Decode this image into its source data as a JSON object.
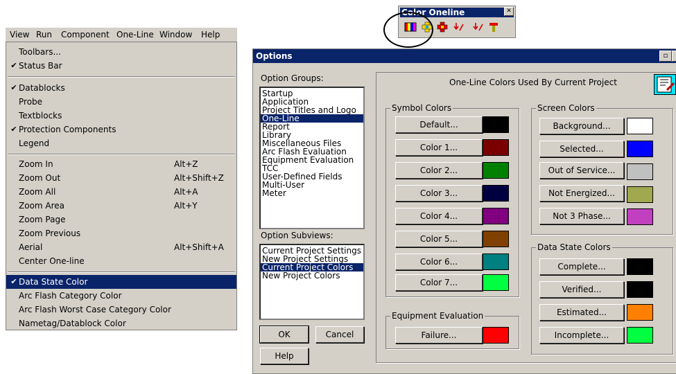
{
  "menubar": {
    "items": [
      "View",
      "Run",
      "Component",
      "One-Line",
      "Window",
      "Help"
    ]
  },
  "menu": {
    "items": [
      {
        "label": "Toolbars...",
        "checked": false
      },
      {
        "label": "Status Bar",
        "checked": true
      },
      {
        "label": "Datablocks",
        "checked": true
      },
      {
        "label": "Probe",
        "checked": false
      },
      {
        "label": "Textblocks",
        "checked": false
      },
      {
        "label": "Protection Components",
        "checked": true
      },
      {
        "label": "Legend",
        "checked": false
      },
      {
        "label": "Zoom In",
        "shortcut": "Alt+Z"
      },
      {
        "label": "Zoom Out",
        "shortcut": "Alt+Shift+Z"
      },
      {
        "label": "Zoom All",
        "shortcut": "Alt+A"
      },
      {
        "label": "Zoom Area",
        "shortcut": "Alt+Y"
      },
      {
        "label": "Zoom Page"
      },
      {
        "label": "Zoom Previous"
      },
      {
        "label": "Aerial",
        "shortcut": "Alt+Shift+A"
      },
      {
        "label": "Center One-line"
      },
      {
        "label": "Data State Color",
        "checked": true,
        "selected": true
      },
      {
        "label": "Arc Flash Category Color"
      },
      {
        "label": "Arc Flash Worst Case Category Color"
      },
      {
        "label": "Nametag/Datablock Color"
      }
    ]
  },
  "toolbar": {
    "title": "Color Oneline",
    "close": "✕"
  },
  "dialog": {
    "title": "Options",
    "option_groups_label": "Option Groups:",
    "option_groups": [
      "Startup",
      "Application",
      "Project Titles and Logo",
      "One-Line",
      "Report",
      "Library",
      "Miscellaneous Files",
      "Arc Flash Evaluation",
      "Equipment Evaluation",
      "TCC",
      "User-Defined Fields",
      "Multi-User",
      "Meter"
    ],
    "option_groups_selected": "One-Line",
    "option_subviews_label": "Option Subviews:",
    "option_subviews": [
      "Current Project Settings",
      "New Project Settings",
      "Current Project Colors",
      "New Project Colors"
    ],
    "option_subviews_selected": "Current Project Colors",
    "ok_label": "OK",
    "cancel_label": "Cancel",
    "help_label": "Help",
    "panel_title": "One-Line Colors Used By Current Project",
    "symbol_colors": {
      "title": "Symbol Colors",
      "items": [
        {
          "label": "Default...",
          "color": "#000000"
        },
        {
          "label": "Color 1...",
          "color": "#7a0000"
        },
        {
          "label": "Color 2...",
          "color": "#008000"
        },
        {
          "label": "Color 3...",
          "color": "#000040"
        },
        {
          "label": "Color 4...",
          "color": "#800080"
        },
        {
          "label": "Color 5...",
          "color": "#804000"
        },
        {
          "label": "Color 6...",
          "color": "#008080"
        },
        {
          "label": "Color 7...",
          "color": "#00ff40"
        }
      ]
    },
    "equipment_evaluation": {
      "title": "Equipment Evaluation",
      "items": [
        {
          "label": "Failure...",
          "color": "#ff0000"
        }
      ]
    },
    "screen_colors": {
      "title": "Screen Colors",
      "items": [
        {
          "label": "Background...",
          "color": "#ffffff"
        },
        {
          "label": "Selected...",
          "color": "#0000ff"
        },
        {
          "label": "Out of Service...",
          "color": "#c0c0c0"
        },
        {
          "label": "Not Energized...",
          "color": "#a0a850"
        },
        {
          "label": "Not 3 Phase...",
          "color": "#c040c0"
        }
      ]
    },
    "data_state_colors": {
      "title": "Data State Colors",
      "items": [
        {
          "label": "Complete...",
          "color": "#000000"
        },
        {
          "label": "Verified...",
          "color": "#000000"
        },
        {
          "label": "Estimated...",
          "color": "#ff8000"
        },
        {
          "label": "Incomplete...",
          "color": "#00ff40"
        }
      ]
    }
  }
}
